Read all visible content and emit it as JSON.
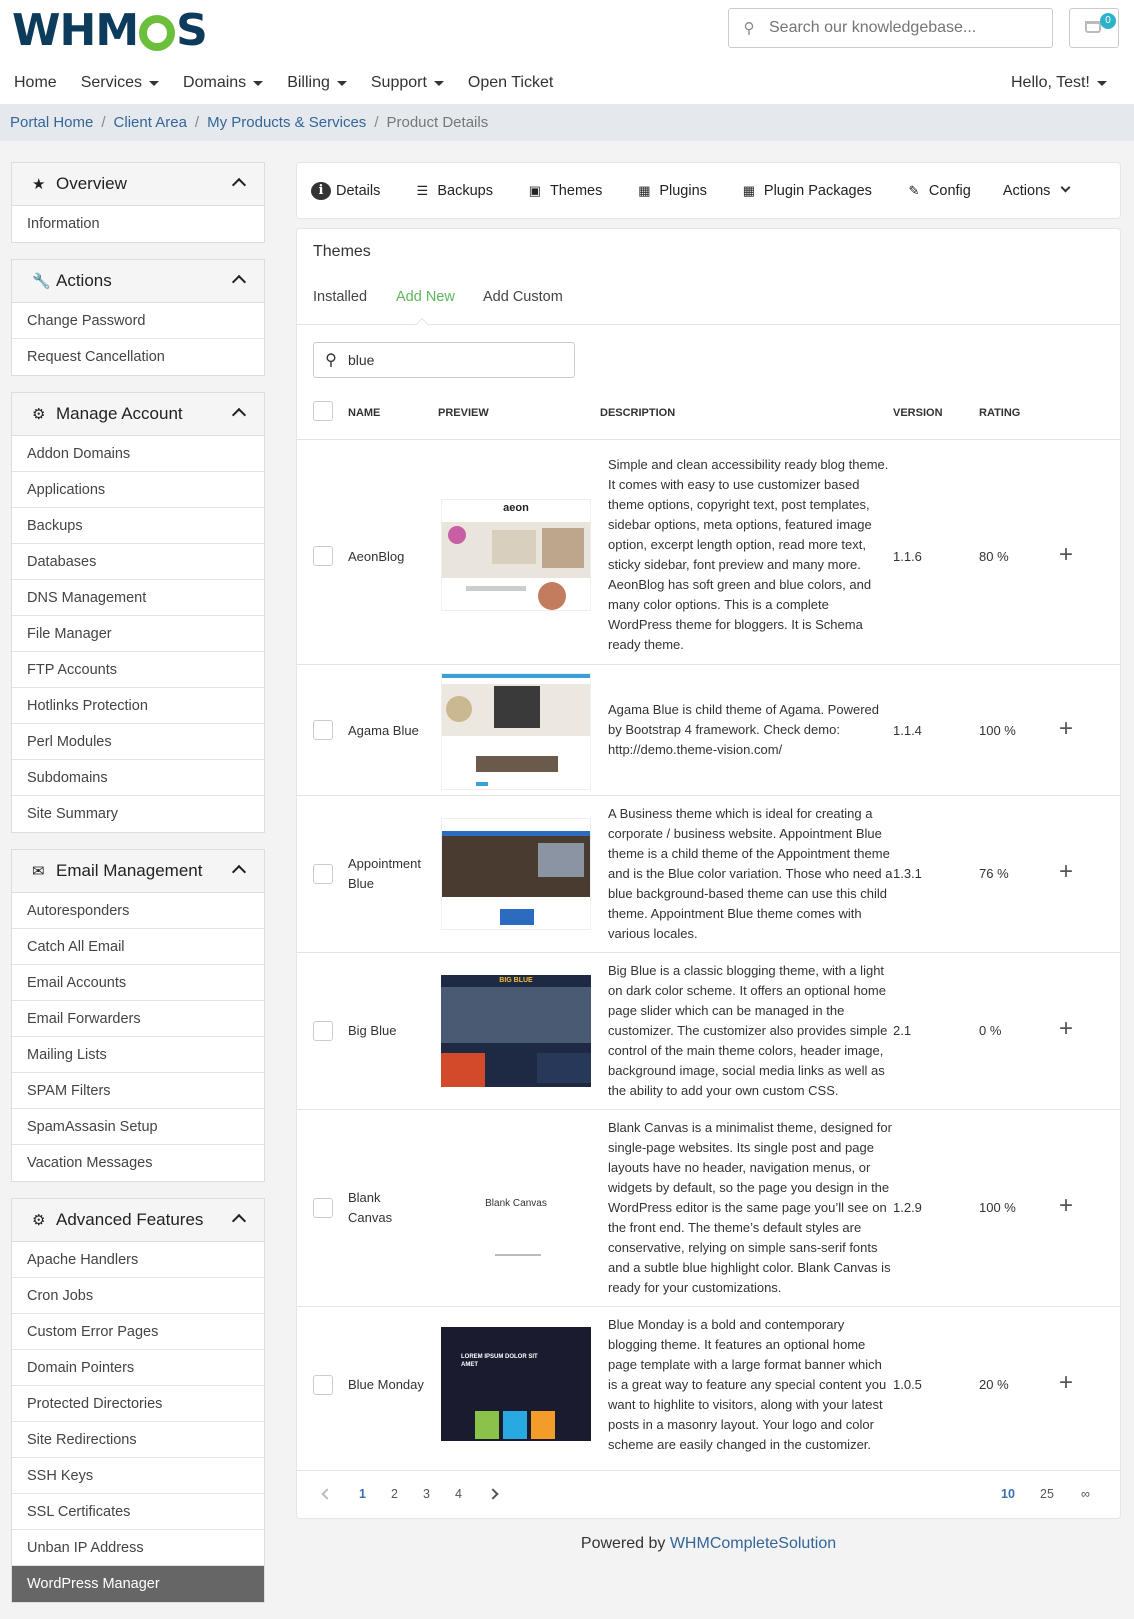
{
  "brand": {
    "logo_text_left": "WHM",
    "logo_text_right": "S"
  },
  "header": {
    "search_placeholder": "Search our knowledgebase...",
    "cart_count": "0",
    "nav": [
      "Home",
      "Services",
      "Domains",
      "Billing",
      "Support",
      "Open Ticket"
    ],
    "user_greeting": "Hello, Test!"
  },
  "breadcrumb": [
    "Portal Home",
    "Client Area",
    "My Products & Services",
    "Product Details"
  ],
  "sidebar": [
    {
      "title": "Overview",
      "icon": "star-icon",
      "items": [
        "Information"
      ]
    },
    {
      "title": "Actions",
      "icon": "wrench-icon",
      "items": [
        "Change Password",
        "Request Cancellation"
      ]
    },
    {
      "title": "Manage Account",
      "icon": "gear-icon",
      "items": [
        "Addon Domains",
        "Applications",
        "Backups",
        "Databases",
        "DNS Management",
        "File Manager",
        "FTP Accounts",
        "Hotlinks Protection",
        "Perl Modules",
        "Subdomains",
        "Site Summary"
      ]
    },
    {
      "title": "Email Management",
      "icon": "envelope-icon",
      "items": [
        "Autoresponders",
        "Catch All Email",
        "Email Accounts",
        "Email Forwarders",
        "Mailing Lists",
        "SPAM Filters",
        "SpamAssasin Setup",
        "Vacation Messages"
      ]
    },
    {
      "title": "Advanced Features",
      "icon": "gears-icon",
      "items": [
        "Apache Handlers",
        "Cron Jobs",
        "Custom Error Pages",
        "Domain Pointers",
        "Protected Directories",
        "Site Redirections",
        "SSH Keys",
        "SSL Certificates",
        "Unban IP Address",
        "WordPress Manager"
      ]
    }
  ],
  "tabs": [
    "Details",
    "Backups",
    "Themes",
    "Plugins",
    "Plugin Packages",
    "Config",
    "Actions"
  ],
  "themes_card": {
    "title": "Themes",
    "subtabs": [
      "Installed",
      "Add New",
      "Add Custom"
    ],
    "active_subtab": "Add New",
    "search_value": "blue",
    "columns": [
      "NAME",
      "PREVIEW",
      "DESCRIPTION",
      "VERSION",
      "RATING"
    ]
  },
  "rows": [
    {
      "name": "AeonBlog",
      "version": "1.1.6",
      "rating": "80 %",
      "preview_caption": "aeon",
      "description": "Simple and clean accessibility ready blog theme. It comes with easy to use customizer based theme options, copyright text, post templates, sidebar options, meta options, featured image option, excerpt length option, read more text, sticky sidebar, font preview and many more. AeonBlog has soft green and blue colors, and many color options. This is a complete WordPress theme for bloggers. It is Schema ready theme."
    },
    {
      "name": "Agama Blue",
      "version": "1.1.4",
      "rating": "100 %",
      "preview_caption": "",
      "description": "Agama Blue is child theme of Agama. Powered by Bootstrap 4 framework. Check demo: http://demo.theme-vision.com/"
    },
    {
      "name": "Appointment Blue",
      "version": "1.3.1",
      "rating": "76 %",
      "preview_caption": "",
      "description": "A Business theme which is ideal for creating a corporate / business website. Appointment Blue theme is a child theme of the Appointment theme and is the Blue color variation. Those who need a blue background-based theme can use this child theme. Appointment Blue theme comes with various locales."
    },
    {
      "name": "Big Blue",
      "version": "2.1",
      "rating": "0 %",
      "preview_caption": "BIG BLUE",
      "description": "Big Blue is a classic blogging theme, with a light on dark color scheme. It offers an optional home page slider which can be managed in the customizer. The customizer also provides simple control of the main theme colors, header image, background image, social media links as well as the ability to add your own custom CSS."
    },
    {
      "name": "Blank Canvas",
      "version": "1.2.9",
      "rating": "100 %",
      "preview_caption": "Blank Canvas",
      "description": "Blank Canvas is a minimalist theme, designed for single-page websites. Its single post and page layouts have no header, navigation menus, or widgets by default, so the page you design in the WordPress editor is the same page you’ll see on the front end. The theme’s default styles are conservative, relying on simple sans-serif fonts and a subtle blue highlight color. Blank Canvas is ready for your customizations."
    },
    {
      "name": "Blue Monday",
      "version": "1.0.5",
      "rating": "20 %",
      "preview_caption": "LOREM IPSUM DOLOR SIT AMET",
      "description": "Blue Monday is a bold and contemporary blogging theme. It features an optional home page template with a large format banner which is a great way to feature any special content you want to highlite to visitors, along with your latest posts in a masonry layout. Your logo and color scheme are easily changed in the customizer."
    }
  ],
  "pagination": {
    "pages": [
      "1",
      "2",
      "3",
      "4"
    ],
    "active_page": "1",
    "per_page": [
      "10",
      "25",
      "∞"
    ],
    "active_per_page": "10"
  },
  "footer": {
    "prefix": "Powered by ",
    "link": "WHMCompleteSolution"
  },
  "colors": {
    "accent_green": "#5cb85c",
    "link_blue": "#336699",
    "brand_navy": "#0d3b5c",
    "brand_green": "#6cbf3a"
  }
}
